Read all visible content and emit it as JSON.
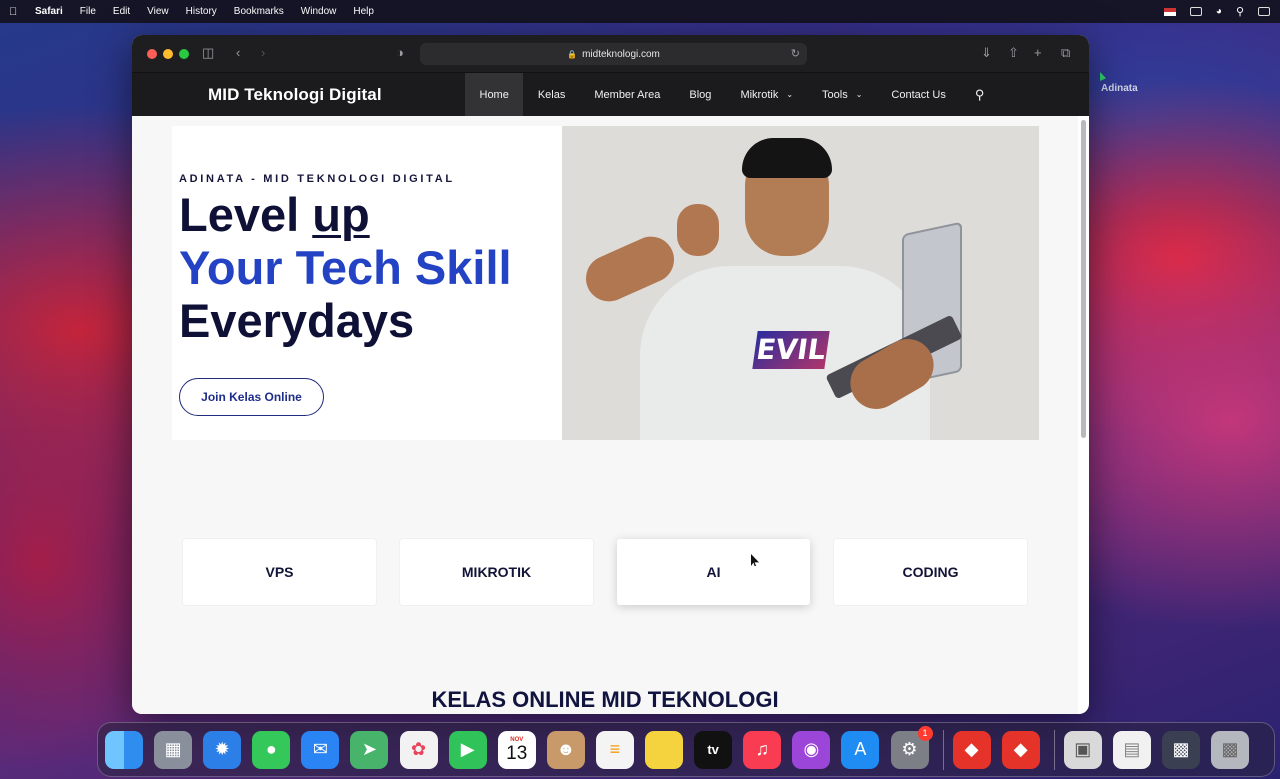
{
  "menubar": {
    "app_name": "Safari",
    "menus": [
      "File",
      "Edit",
      "View",
      "History",
      "Bookmarks",
      "Window",
      "Help"
    ]
  },
  "desktop": {
    "item_label": "Adinata"
  },
  "browser": {
    "url": "midteknologi.com"
  },
  "site": {
    "brand": "MID Teknologi Digital",
    "nav": [
      {
        "label": "Home",
        "active": true
      },
      {
        "label": "Kelas"
      },
      {
        "label": "Member Area"
      },
      {
        "label": "Blog"
      },
      {
        "label": "Mikrotik",
        "dropdown": true
      },
      {
        "label": "Tools",
        "dropdown": true
      },
      {
        "label": "Contact Us"
      }
    ],
    "hero": {
      "eyebrow": "ADINATA - MID TEKNOLOGI DIGITAL",
      "line1_a": "Level ",
      "line1_b": "up ",
      "line2": "Your Tech Skill",
      "line3": "Everydays",
      "cta": "Join Kelas Online",
      "shirt_text": "EVIL"
    },
    "categories": [
      "VPS",
      "MIKROTIK",
      "AI",
      "CODING"
    ],
    "section_title": "KELAS ONLINE MID TEKNOLOGI"
  },
  "dock": {
    "apps": [
      {
        "name": "finder",
        "color": "#2f8df0"
      },
      {
        "name": "launchpad",
        "color": "#8a8f9c"
      },
      {
        "name": "safari",
        "color": "#2d7fe8"
      },
      {
        "name": "messages",
        "color": "#34c759"
      },
      {
        "name": "mail",
        "color": "#2a84f3"
      },
      {
        "name": "maps",
        "color": "#47b36b"
      },
      {
        "name": "photos",
        "color": "#f2f2f2"
      },
      {
        "name": "facetime",
        "color": "#2fc35a"
      },
      {
        "name": "calendar",
        "month": "NOV",
        "day": "13"
      },
      {
        "name": "contacts",
        "color": "#c89a6a"
      },
      {
        "name": "reminders",
        "color": "#f4f4f4"
      },
      {
        "name": "notes",
        "color": "#f5d33f"
      },
      {
        "name": "tv",
        "color": "#111111",
        "label": "tv"
      },
      {
        "name": "music",
        "color": "#fa3c52"
      },
      {
        "name": "podcasts",
        "color": "#9b46d8"
      },
      {
        "name": "app-store",
        "color": "#1f8cf4"
      },
      {
        "name": "system-preferences",
        "color": "#7c7f86",
        "badge": "1"
      }
    ],
    "apps_right": [
      {
        "name": "anydesk",
        "color": "#e5332a"
      },
      {
        "name": "anydesk-2",
        "color": "#e5332a"
      }
    ],
    "docs": [
      {
        "name": "disk-image",
        "color": "#d9d9d9"
      },
      {
        "name": "document-preview",
        "color": "#f1f1f1"
      },
      {
        "name": "screen-recording",
        "color": "#3a3f52"
      },
      {
        "name": "trash",
        "color": "#b4b7bd"
      }
    ]
  }
}
